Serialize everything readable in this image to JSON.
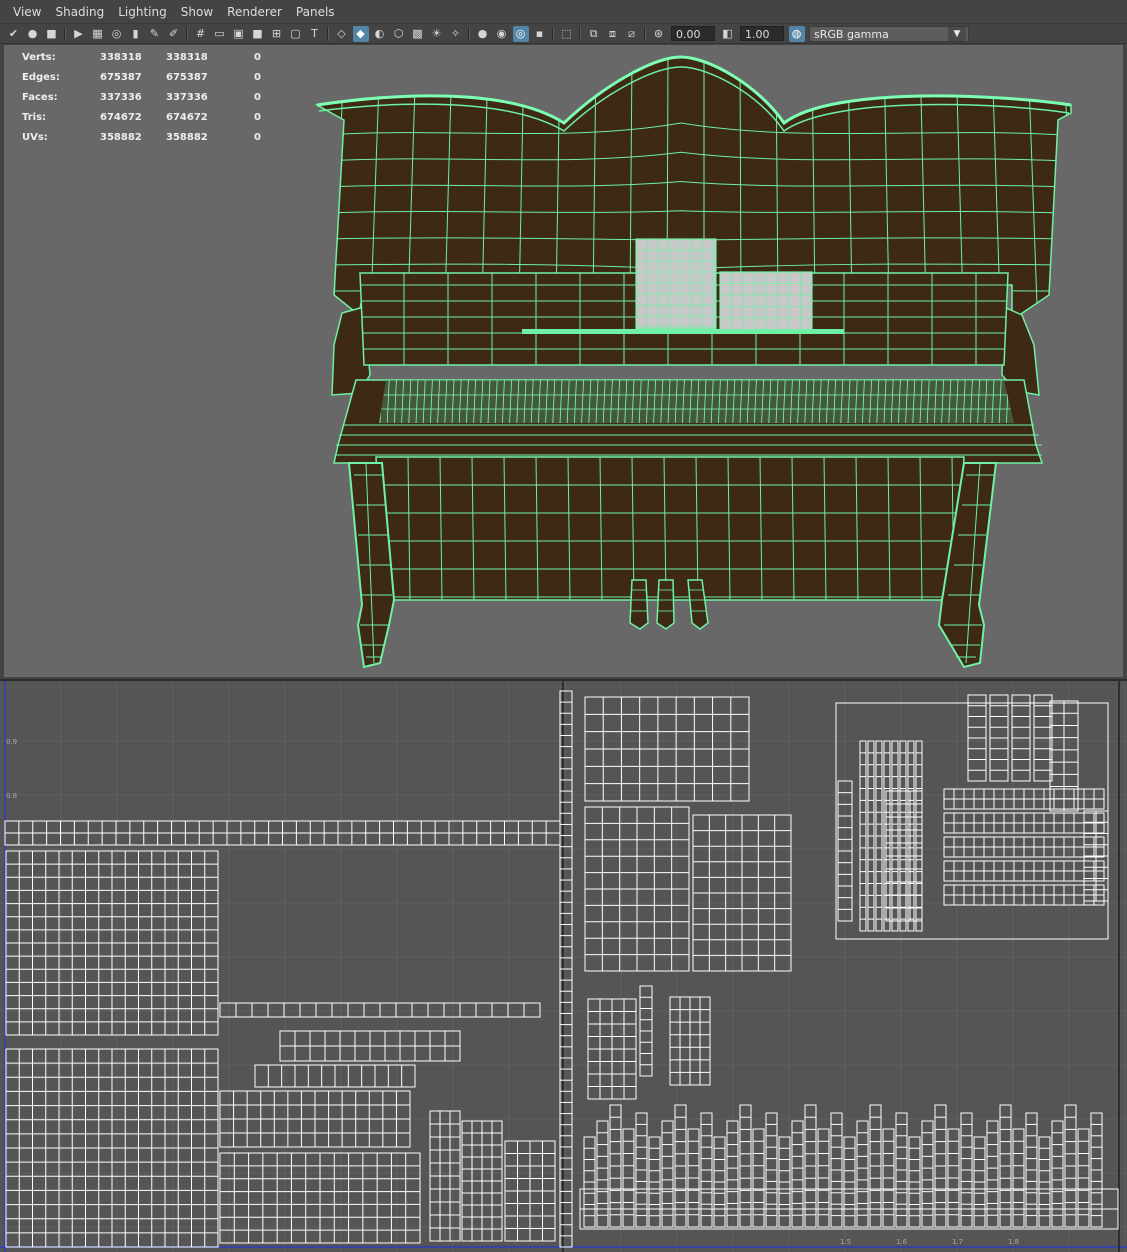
{
  "menu": [
    "View",
    "Shading",
    "Lighting",
    "Show",
    "Renderer",
    "Panels"
  ],
  "toolbar": {
    "exposure": "0.00",
    "gamma": "1.00",
    "color_space": "sRGB gamma"
  },
  "hud": {
    "rows": [
      {
        "label": "Verts:",
        "v1": "338318",
        "v2": "338318",
        "v3": "0"
      },
      {
        "label": "Edges:",
        "v1": "675387",
        "v2": "675387",
        "v3": "0"
      },
      {
        "label": "Faces:",
        "v1": "337336",
        "v2": "337336",
        "v3": "0"
      },
      {
        "label": "Tris:",
        "v1": "674672",
        "v2": "674672",
        "v3": "0"
      },
      {
        "label": "UVs:",
        "v1": "358882",
        "v2": "358882",
        "v3": "0"
      }
    ]
  },
  "uv_axis": {
    "left_ticks": [
      "0.9",
      "0.8"
    ],
    "bottom_ticks": [
      "1.5",
      "1.6",
      "1.7",
      "1.8"
    ]
  },
  "colors": {
    "wire": "#6ef0a5",
    "wood": "#3e2a14",
    "viewport_bg": "#686868",
    "uv_bg": "#555555",
    "uv_line": "#ffffff",
    "selection": "#5285a6"
  }
}
